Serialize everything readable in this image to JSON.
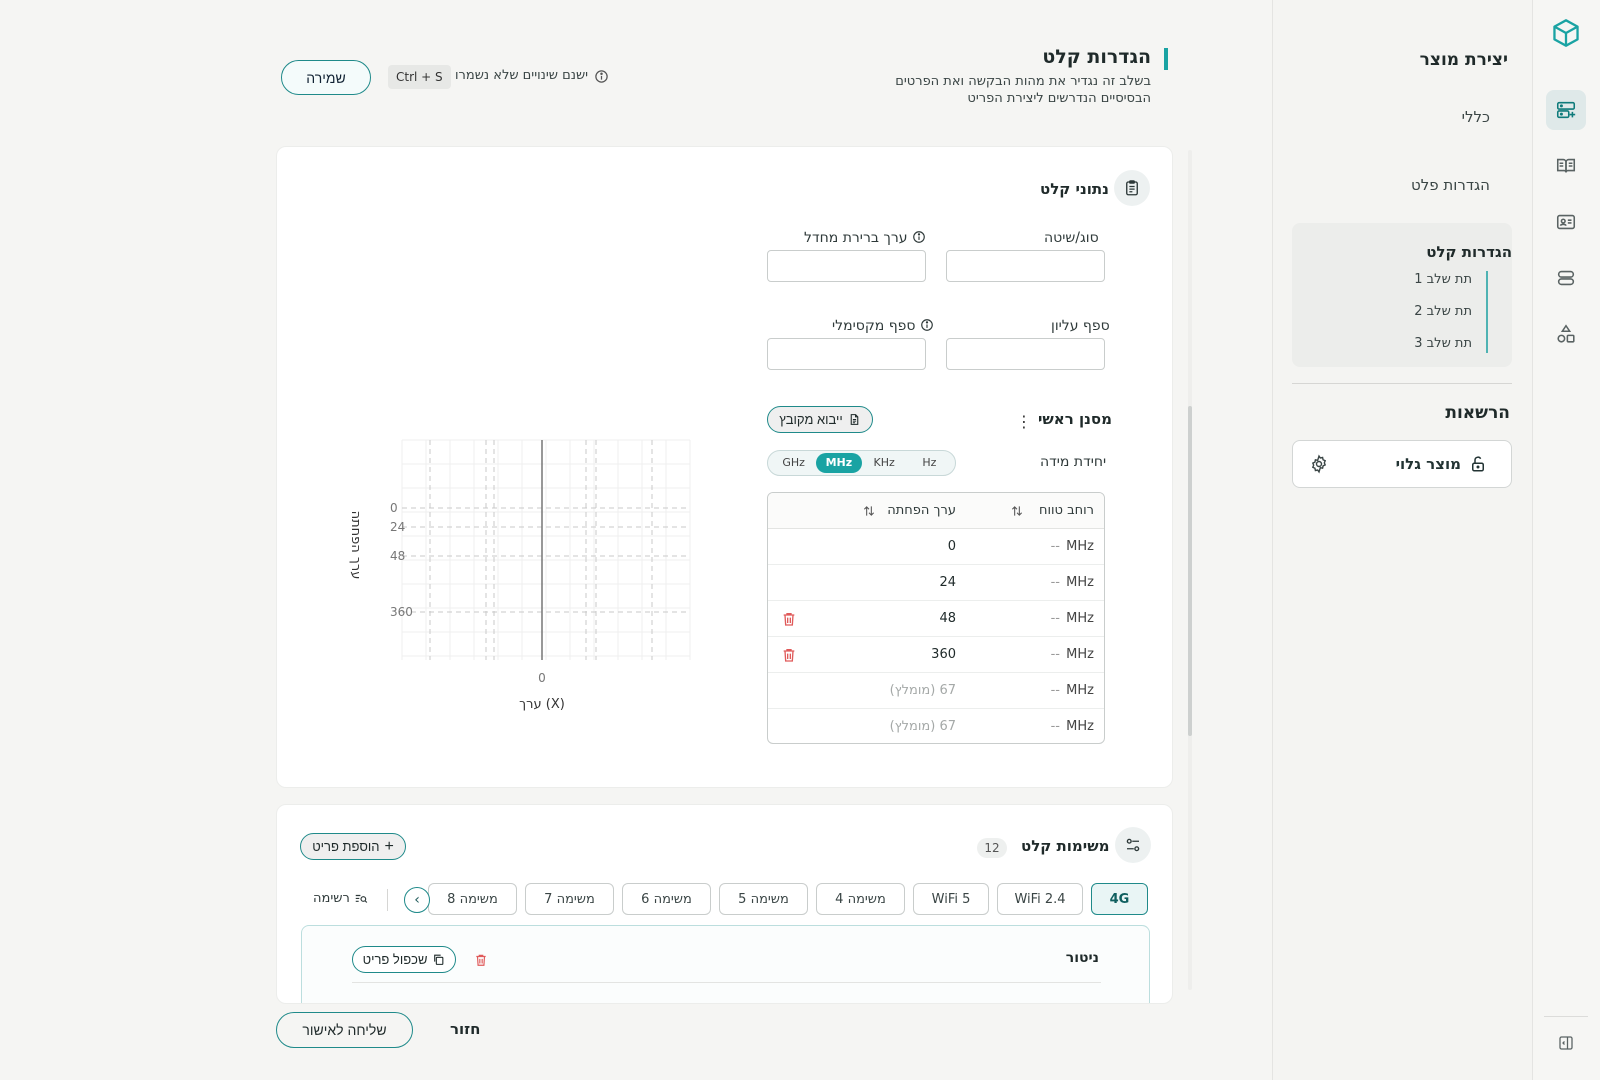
{
  "sidebar": {
    "title": "יצירת מוצר",
    "steps": [
      "כללי",
      "הגדרות פלט"
    ],
    "active_group": {
      "title": "הגדרות קלט",
      "substeps": [
        "תת שלב 1",
        "תת שלב 2",
        "תת שלב 3"
      ]
    },
    "permissions_title": "הרשאות",
    "permission_item": "מוצר גלוי"
  },
  "header": {
    "title": "הגדרות קלט",
    "subtitle": "בשלב זה נגדיר את מהות הבקשה ואת הפרטים הבסיסיים הנדרשים ליצירת הפריט",
    "save_label": "שמירה",
    "shortcut": "Ctrl + S",
    "unsaved_text": "ישנם שינויים שלא נשמרו"
  },
  "input_data": {
    "title": "נתוני קלט",
    "fields": {
      "type_label": "סוג/שיטה",
      "default_label": "ערך ברירת מחדל",
      "upper_label": "ספף עליון",
      "max_label": "ספף מקסימלי"
    },
    "filter_title": "מסנן ראשי",
    "import_label": "ייבוא מקובץ",
    "unit_label": "יחידת מידה",
    "units": [
      "GHz",
      "MHz",
      "KHz",
      "Hz"
    ],
    "selected_unit": "MHz",
    "table": {
      "col_range": "רוחב טווח",
      "col_attenuation": "ערך הפחתה",
      "rows": [
        {
          "unit": "MHz",
          "range": "--",
          "value": "0",
          "placeholder": false,
          "deletable": false
        },
        {
          "unit": "MHz",
          "range": "--",
          "value": "24",
          "placeholder": false,
          "deletable": false
        },
        {
          "unit": "MHz",
          "range": "--",
          "value": "48",
          "placeholder": false,
          "deletable": true
        },
        {
          "unit": "MHz",
          "range": "--",
          "value": "360",
          "placeholder": false,
          "deletable": true
        },
        {
          "unit": "MHz",
          "range": "--",
          "value": "67 (מומלץ)",
          "placeholder": true,
          "deletable": false
        },
        {
          "unit": "MHz",
          "range": "--",
          "value": "67 (מומלץ)",
          "placeholder": true,
          "deletable": false
        }
      ]
    }
  },
  "chart_data": {
    "type": "line",
    "xlabel": "ערך (X)",
    "ylabel": "ערך הפחתה",
    "x_ticks": [
      "0"
    ],
    "y_ticks": [
      "0",
      "24",
      "48",
      "360"
    ],
    "grid": true
  },
  "tasks": {
    "title": "משימות קלט",
    "count": "12",
    "add_label": "הוספת פריט",
    "tabs": [
      "4G",
      "WiFi 2.4",
      "WiFi 5",
      "משימה 4",
      "משימה 5",
      "משימה 6",
      "משימה 7",
      "משימה 8"
    ],
    "active_tab": "4G",
    "list_label": "רשימה",
    "item": {
      "title": "ניטור",
      "duplicate_label": "שכפול פריט"
    }
  },
  "footer": {
    "submit_label": "שליחה לאישור",
    "back_label": "חזור"
  }
}
